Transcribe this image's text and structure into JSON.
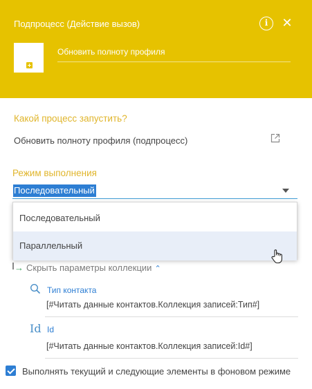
{
  "header": {
    "title": "Подпроцесс (Действие вызов)",
    "element_name": "Обновить полноту профиля",
    "info_icon": "info-icon",
    "close_icon": "close-icon",
    "background_color": "#e6c200"
  },
  "process_section": {
    "label": "Какой процесс запустить?",
    "value": "Обновить полноту профиля (подпроцесс)",
    "open_icon": "open-link-icon"
  },
  "mode_section": {
    "label": "Режим выполнения",
    "selected_value": "Последовательный",
    "options": [
      "Последовательный",
      "Параллельный"
    ],
    "highlighted_option": "Параллельный"
  },
  "collection": {
    "toggle_label": "Скрыть параметры коллекции",
    "params": [
      {
        "icon": "search-icon",
        "name": "Тип контакта",
        "value": "[#Читать данные контактов.Коллекция записей:Тип#]"
      },
      {
        "icon": "Id",
        "name": "Id",
        "value": "[#Читать данные контактов.Коллекция записей:Id#]"
      }
    ]
  },
  "background_mode": {
    "label": "Выполнять текущий и следующие элементы в фоновом режиме",
    "checked": true
  },
  "colors": {
    "accent_yellow": "#e6c200",
    "label_gold": "#e0b52b",
    "link_blue": "#2d7ed3"
  }
}
